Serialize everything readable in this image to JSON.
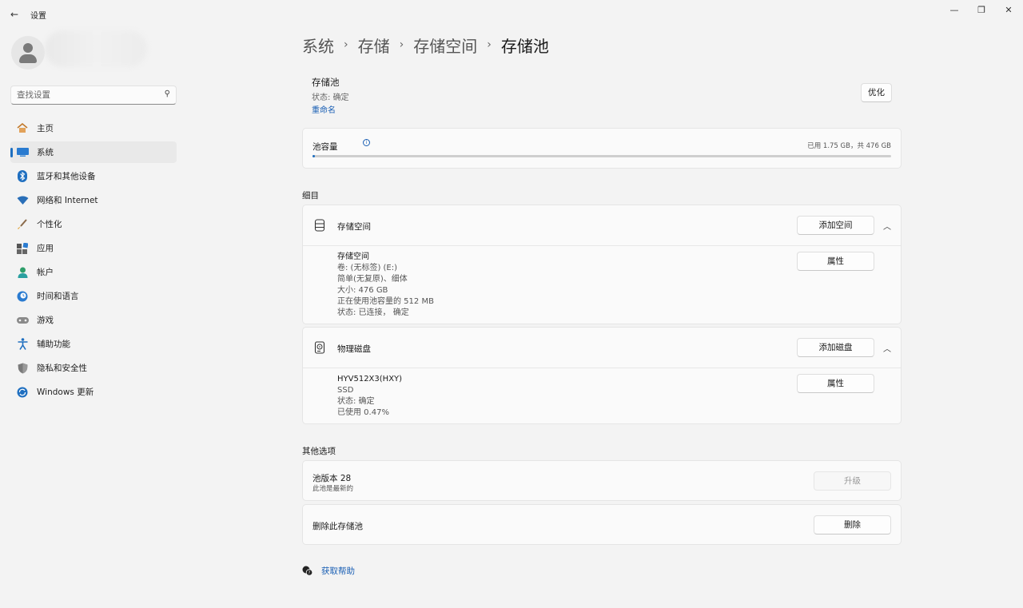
{
  "app": {
    "title": "设置",
    "back_icon": "back-arrow-icon"
  },
  "window_controls": {
    "minimize": "—",
    "restore": "❐",
    "close": "✕"
  },
  "sidebar": {
    "search_placeholder": "查找设置",
    "items": [
      {
        "label": "主页",
        "icon": "home-icon",
        "active": false
      },
      {
        "label": "系统",
        "icon": "system-icon",
        "active": true
      },
      {
        "label": "蓝牙和其他设备",
        "icon": "bluetooth-icon",
        "active": false
      },
      {
        "label": "网络和 Internet",
        "icon": "wifi-icon",
        "active": false
      },
      {
        "label": "个性化",
        "icon": "brush-icon",
        "active": false
      },
      {
        "label": "应用",
        "icon": "apps-icon",
        "active": false
      },
      {
        "label": "帐户",
        "icon": "account-icon",
        "active": false
      },
      {
        "label": "时间和语言",
        "icon": "clock-globe-icon",
        "active": false
      },
      {
        "label": "游戏",
        "icon": "gamepad-icon",
        "active": false
      },
      {
        "label": "辅助功能",
        "icon": "accessibility-icon",
        "active": false
      },
      {
        "label": "隐私和安全性",
        "icon": "shield-icon",
        "active": false
      },
      {
        "label": "Windows 更新",
        "icon": "update-icon",
        "active": false
      }
    ]
  },
  "breadcrumb": [
    "系统",
    "存储",
    "存储空间",
    "存储池"
  ],
  "pool": {
    "title": "存储池",
    "status": "状态: 确定",
    "rename_link": "重命名",
    "optimize_button": "优化"
  },
  "capacity": {
    "label": "池容量",
    "value_text": "已用 1.75 GB，共 476 GB",
    "used_fraction": 0.0037
  },
  "details_heading": "细目",
  "storage_spaces": {
    "title": "存储空间",
    "add_button": "添加空间",
    "properties_button": "属性",
    "lines": [
      "存储空间",
      "卷: (无标签) (E:)",
      "简单(无复原)、细体",
      "大小: 476 GB",
      "正在使用池容量的 512 MB",
      "状态: 已连接， 确定"
    ]
  },
  "physical_disks": {
    "title": "物理磁盘",
    "add_button": "添加磁盘",
    "properties_button": "属性",
    "lines": [
      "HYV512X3(HXY)",
      "SSD",
      "状态: 确定",
      "已使用 0.47%"
    ]
  },
  "other_options": {
    "heading": "其他选项",
    "pool_version_title": "池版本 28",
    "pool_version_sub": "此池是最新的",
    "upgrade_button": "升级",
    "delete_title": "删除此存储池",
    "delete_button": "删除"
  },
  "help": {
    "link": "获取帮助"
  },
  "colors": {
    "accent": "#1f6fc0",
    "link": "#1a5fb4",
    "background": "#f3f3f3",
    "card": "#fafafa"
  }
}
